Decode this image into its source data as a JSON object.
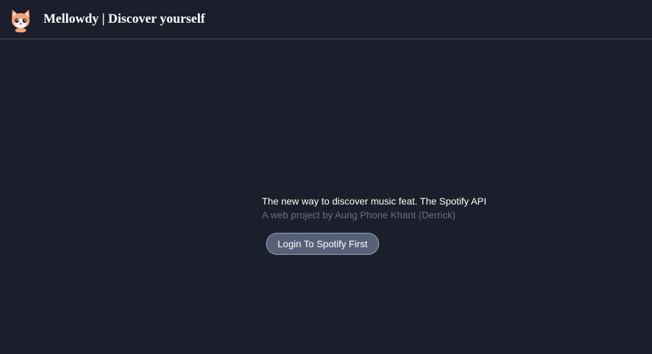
{
  "header": {
    "logo_icon": "fox-mascot-icon",
    "title": "Mellowdy | Discover yourself"
  },
  "hero": {
    "tagline": "The new way to discover music feat. The Spotify API",
    "byline": "A web project by Aung Phone Khant (Derrick)",
    "login_label": "Login To Spotify First"
  },
  "colors": {
    "background": "#1b1f2b",
    "button_fill": "#566178",
    "button_border": "#9aa3b3",
    "byline_text": "#6d717b"
  }
}
